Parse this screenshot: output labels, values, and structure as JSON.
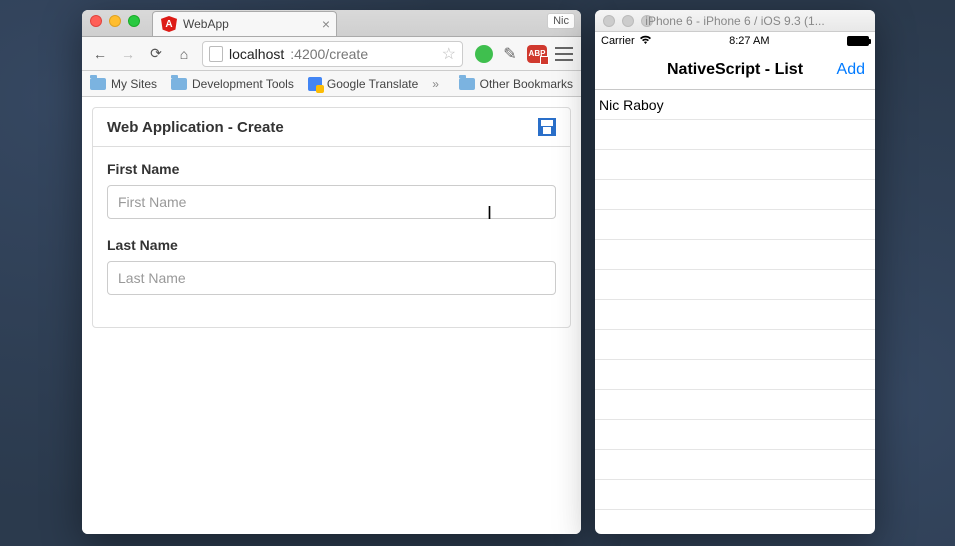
{
  "browser": {
    "profile_label": "Nic",
    "tab": {
      "title": "WebApp"
    },
    "url": {
      "host": "localhost",
      "port_path": ":4200/create"
    },
    "bookmarks": {
      "my_sites": "My Sites",
      "dev_tools": "Development Tools",
      "google_translate": "Google Translate",
      "overflow": "»",
      "other": "Other Bookmarks"
    }
  },
  "webapp": {
    "panel_title": "Web Application - Create",
    "first_name_label": "First Name",
    "first_name_placeholder": "First Name",
    "first_name_value": "",
    "last_name_label": "Last Name",
    "last_name_placeholder": "Last Name",
    "last_name_value": ""
  },
  "simulator": {
    "window_title": "iPhone 6 - iPhone 6 / iOS 9.3 (1...",
    "status": {
      "carrier": "Carrier",
      "time": "8:27 AM"
    },
    "nav": {
      "title": "NativeScript - List",
      "add_label": "Add"
    },
    "list": [
      "Nic Raboy"
    ]
  }
}
